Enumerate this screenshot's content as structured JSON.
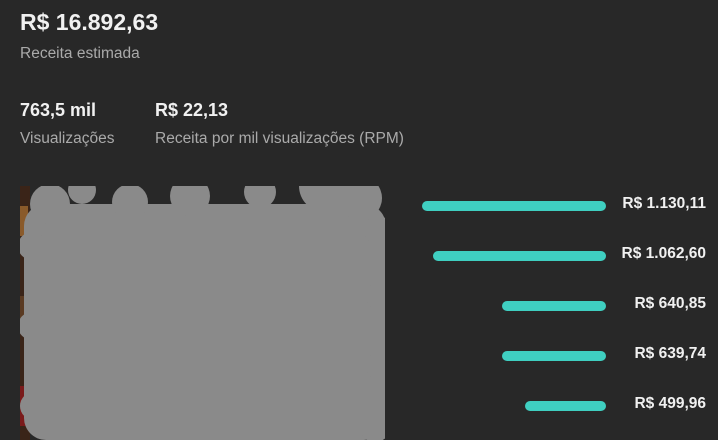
{
  "summary": {
    "total_revenue": "R$ 16.892,63",
    "total_revenue_label": "Receita estimada"
  },
  "metrics": [
    {
      "value": "763,5 mil",
      "label": "Visualizações"
    },
    {
      "value": "R$ 22,13",
      "label": "Receita por mil visualizações (RPM)"
    }
  ],
  "top_content": [
    {
      "amount": "R$ 1.130,11",
      "bar_fraction": 1.0
    },
    {
      "amount": "R$ 1.062,60",
      "bar_fraction": 0.94
    },
    {
      "amount": "R$ 640,85",
      "bar_fraction": 0.567
    },
    {
      "amount": "R$ 639,74",
      "bar_fraction": 0.566
    },
    {
      "amount": "R$ 499,96",
      "bar_fraction": 0.442
    }
  ],
  "colors": {
    "background": "#282828",
    "bar": "#3fcfc1",
    "redaction": "#8a8a8a",
    "primary_text": "#f1f1f1",
    "secondary_text": "#aaaaaa"
  }
}
